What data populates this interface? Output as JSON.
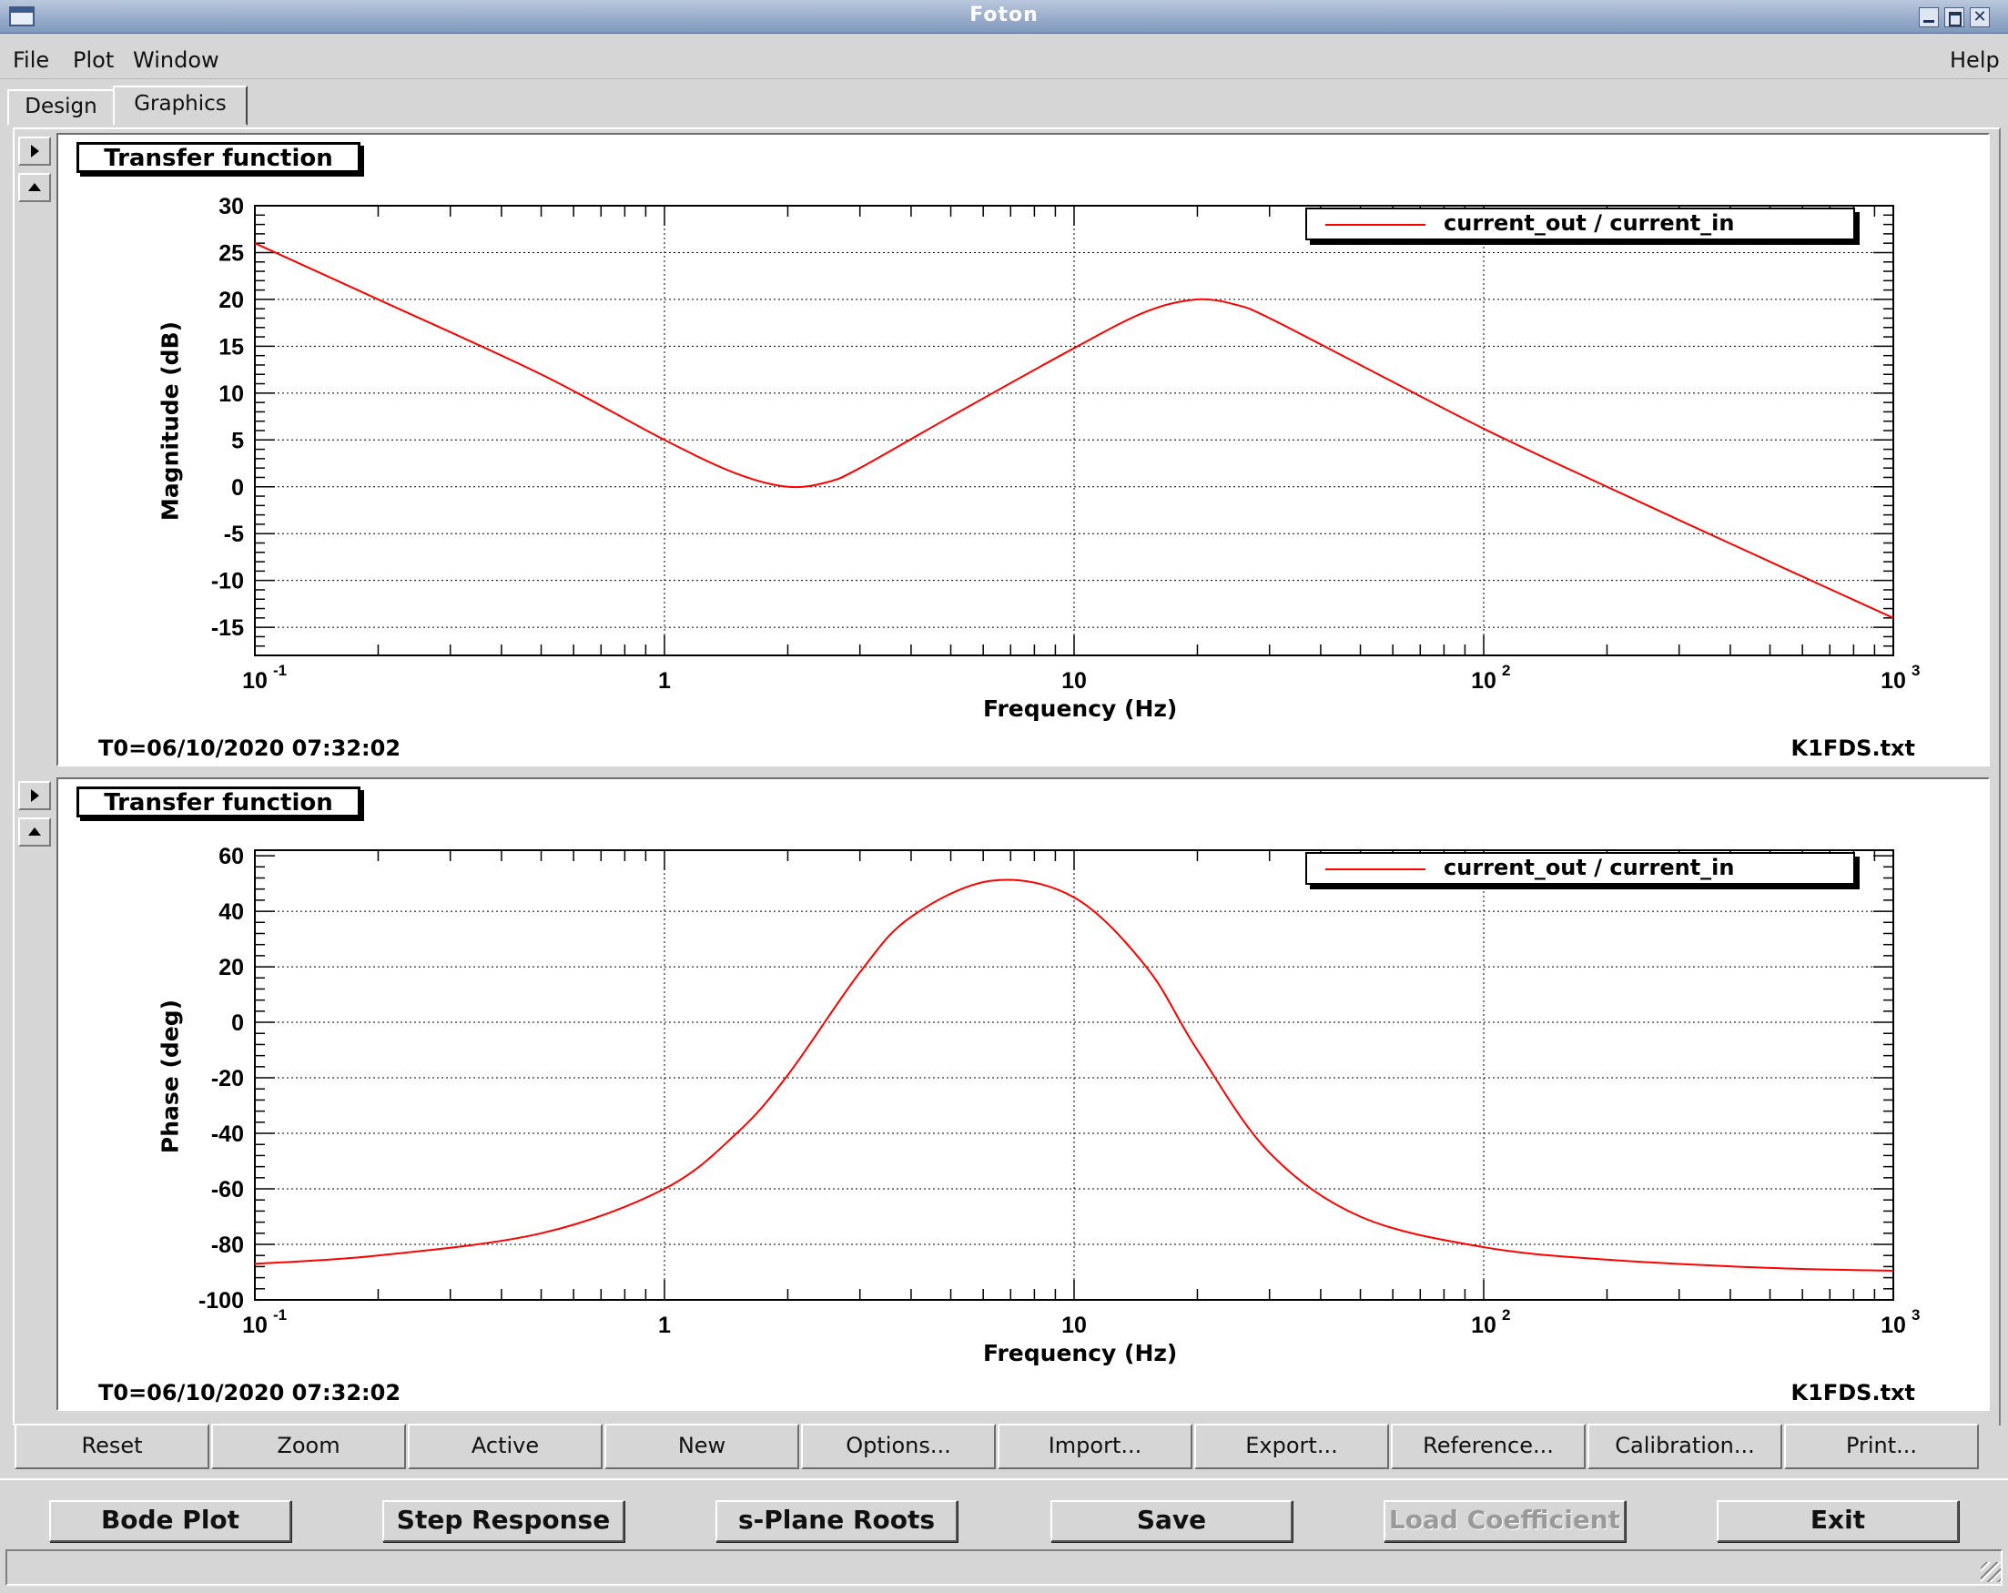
{
  "window": {
    "title": "Foton"
  },
  "menubar": {
    "file": "File",
    "plot": "Plot",
    "window": "Window",
    "help": "Help"
  },
  "tabs": {
    "design": "Design",
    "graphics": "Graphics"
  },
  "panels": [
    {
      "label": "Transfer function",
      "legend": "current_out / current_in",
      "ylabel": "Magnitude (dB)",
      "xlabel": "Frequency (Hz)",
      "t0": "T0=06/10/2020 07:32:02",
      "file": "K1FDS.txt",
      "yticks": [
        "30",
        "25",
        "20",
        "15",
        "10",
        "5",
        "0",
        "-5",
        "-10",
        "-15"
      ]
    },
    {
      "label": "Transfer function",
      "legend": "current_out / current_in",
      "ylabel": "Phase (deg)",
      "xlabel": "Frequency (Hz)",
      "t0": "T0=06/10/2020 07:32:02",
      "file": "K1FDS.txt",
      "yticks": [
        "60",
        "40",
        "20",
        "0",
        "-20",
        "-40",
        "-60",
        "-80",
        "-100"
      ]
    }
  ],
  "chart_data": [
    {
      "type": "line",
      "title": "Transfer function",
      "xlabel": "Frequency (Hz)",
      "ylabel": "Magnitude (dB)",
      "xscale": "log",
      "xlim": [
        0.1,
        1000
      ],
      "ylim": [
        -18,
        30
      ],
      "xtick_labels": [
        "10",
        "1",
        "10",
        "10",
        "10"
      ],
      "grid": true,
      "legend_position": "top-right",
      "series": [
        {
          "name": "current_out / current_in",
          "color": "#ff0000",
          "x": [
            0.1,
            0.2,
            0.5,
            1,
            1.5,
            2,
            2.5,
            3,
            5,
            10,
            15,
            20,
            25,
            30,
            50,
            100,
            200,
            500,
            1000
          ],
          "y": [
            26,
            20,
            12,
            5,
            1.4,
            0,
            0.5,
            2,
            7.5,
            14.8,
            18.7,
            20,
            19.4,
            18,
            13,
            6.2,
            0,
            -8,
            -14
          ]
        }
      ]
    },
    {
      "type": "line",
      "title": "Transfer function",
      "xlabel": "Frequency (Hz)",
      "ylabel": "Phase (deg)",
      "xscale": "log",
      "xlim": [
        0.1,
        1000
      ],
      "ylim": [
        -100,
        62
      ],
      "xtick_labels": [
        "10",
        "1",
        "10",
        "10",
        "10"
      ],
      "grid": true,
      "legend_position": "top-right",
      "series": [
        {
          "name": "current_out / current_in",
          "color": "#ff0000",
          "x": [
            0.1,
            0.2,
            0.5,
            1,
            1.5,
            2,
            3,
            4,
            6.3,
            10,
            15,
            20,
            30,
            50,
            100,
            200,
            500,
            1000
          ],
          "y": [
            -87,
            -84,
            -76,
            -60,
            -40,
            -19,
            18,
            38,
            51,
            45,
            20,
            -10,
            -47,
            -70,
            -81,
            -85.5,
            -88.5,
            -89.5
          ]
        }
      ]
    }
  ],
  "toolbar": [
    "Reset",
    "Zoom",
    "Active",
    "New",
    "Options...",
    "Import...",
    "Export...",
    "Reference...",
    "Calibration...",
    "Print..."
  ],
  "actions": [
    "Bode Plot",
    "Step Response",
    "s-Plane Roots",
    "Save",
    "Load Coefficient",
    "Exit"
  ]
}
